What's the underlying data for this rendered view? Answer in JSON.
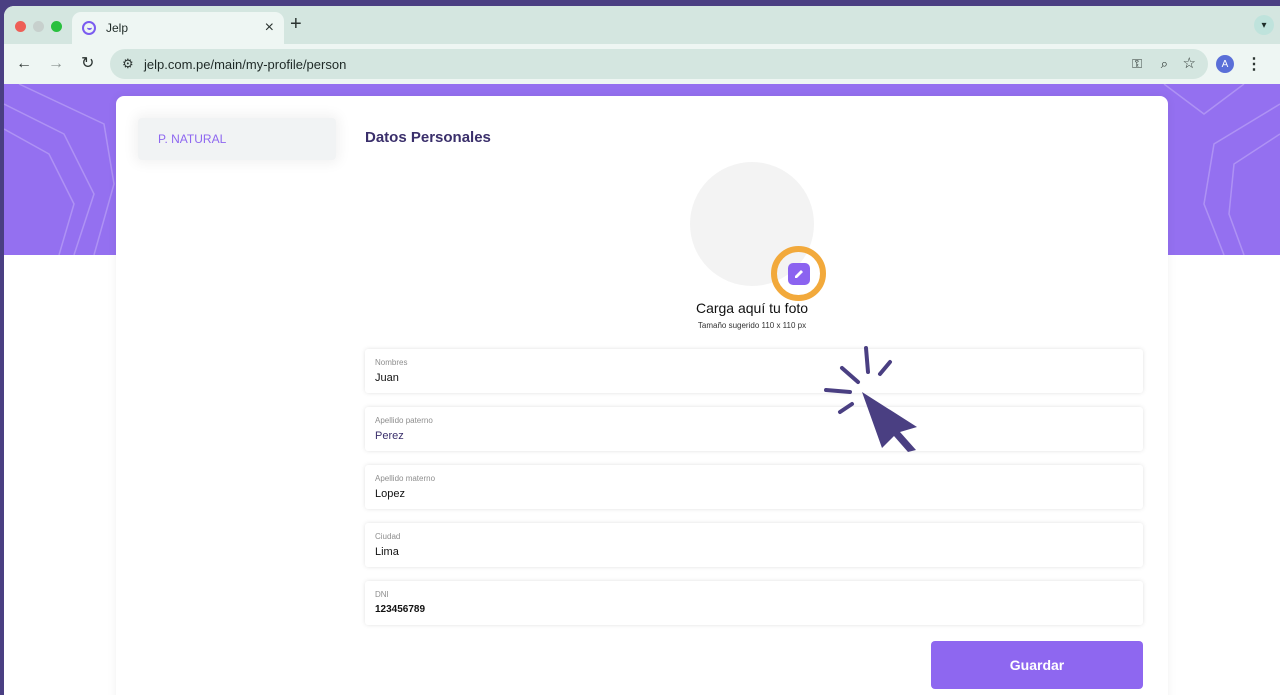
{
  "browser": {
    "tab_title": "Jelp",
    "tab_close": "×",
    "new_tab": "+",
    "url": "jelp.com.pe/main/my-profile/person",
    "avatar_letter": "A"
  },
  "sidebar": {
    "tab_label": "P. NATURAL"
  },
  "profile": {
    "section_title": "Datos Personales",
    "upload_title": "Carga aquí tu foto",
    "upload_hint": "Tamaño sugerido 110 x 110 px"
  },
  "form": {
    "fields": [
      {
        "label": "Nombres",
        "value": "Juan"
      },
      {
        "label": "Apellido paterno",
        "value": "Perez"
      },
      {
        "label": "Apellido materno",
        "value": "Lopez"
      },
      {
        "label": "Ciudad",
        "value": "Lima"
      },
      {
        "label": "DNI",
        "value": "123456789"
      }
    ],
    "save_label": "Guardar"
  },
  "colors": {
    "brand_purple": "#8e67f0",
    "highlight_orange": "#f2a93b",
    "cursor_indigo": "#4a3f82"
  },
  "icons": [
    "edit-icon",
    "pointer-cursor-icon",
    "back-icon",
    "forward-icon",
    "reload-icon",
    "star-icon",
    "zoom-icon",
    "key-icon"
  ]
}
